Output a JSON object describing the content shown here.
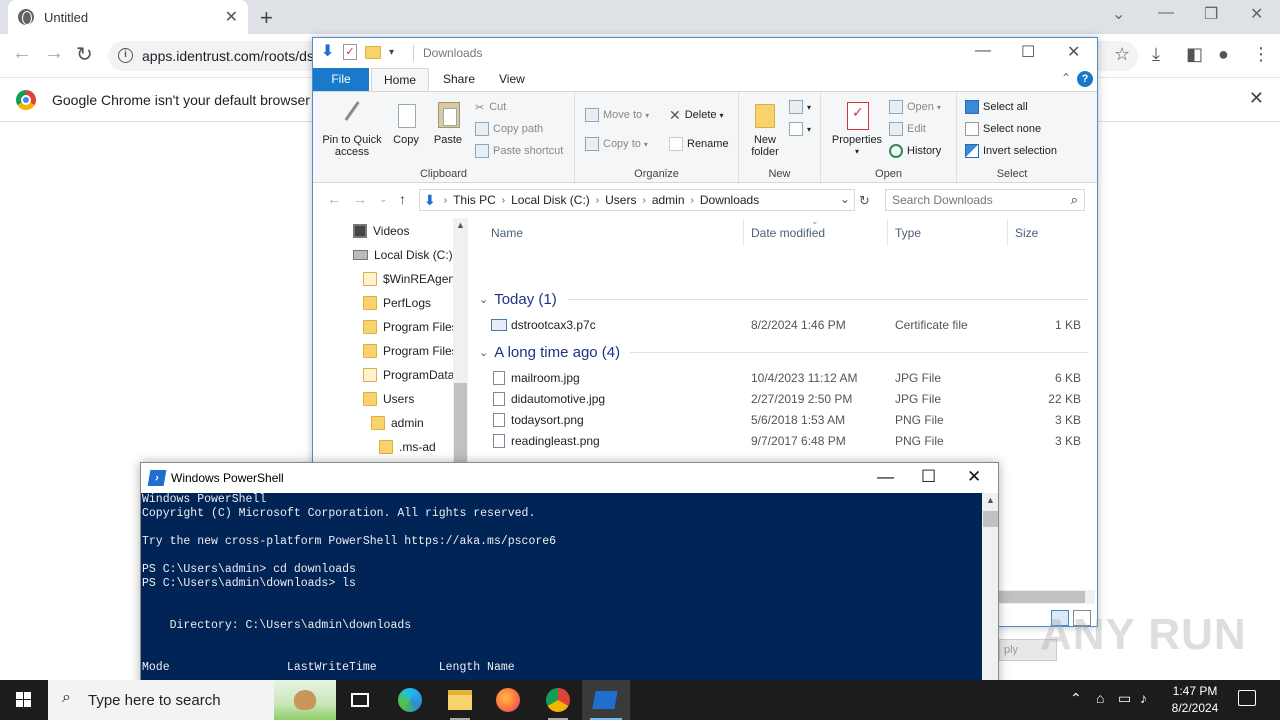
{
  "chrome": {
    "tab_title": "Untitled",
    "tab_close": "✕",
    "new_tab": "+",
    "url": "apps.identrust.com/roots/ds",
    "infobar_message": "Google Chrome isn't your default browser",
    "infobar_close": "✕"
  },
  "explorer": {
    "title": "Downloads",
    "tabs": [
      "File",
      "Home",
      "Share",
      "View"
    ],
    "help": "?",
    "clipboard": {
      "label": "Clipboard",
      "pin": "Pin to Quick access",
      "copy": "Copy",
      "paste": "Paste",
      "cut": "Cut",
      "copy_path": "Copy path",
      "paste_shortcut": "Paste shortcut"
    },
    "organize": {
      "label": "Organize",
      "move_to": "Move to",
      "copy_to": "Copy to",
      "delete": "Delete",
      "rename": "Rename"
    },
    "new": {
      "label": "New",
      "new_folder": "New folder"
    },
    "open": {
      "label": "Open",
      "properties": "Properties",
      "open": "Open",
      "edit": "Edit",
      "history": "History"
    },
    "select": {
      "label": "Select",
      "select_all": "Select all",
      "select_none": "Select none",
      "invert": "Invert selection"
    },
    "breadcrumb": [
      "This PC",
      "Local Disk (C:)",
      "Users",
      "admin",
      "Downloads"
    ],
    "search_placeholder": "Search Downloads",
    "nav_items": [
      {
        "label": "Videos"
      },
      {
        "label": "Local Disk (C:)"
      },
      {
        "label": "$WinREAgent"
      },
      {
        "label": "PerfLogs"
      },
      {
        "label": "Program Files"
      },
      {
        "label": "Program Files"
      },
      {
        "label": "ProgramData"
      },
      {
        "label": "Users"
      },
      {
        "label": "admin"
      },
      {
        "label": ".ms-ad"
      }
    ],
    "columns": [
      "Name",
      "Date modified",
      "Type",
      "Size"
    ],
    "groups": [
      {
        "label": "Today (1)",
        "files": [
          {
            "name": "dstrootcax3.p7c",
            "date": "8/2/2024 1:46 PM",
            "type": "Certificate file",
            "size": "1 KB",
            "icon": "certificate-icon"
          }
        ]
      },
      {
        "label": "A long time ago (4)",
        "files": [
          {
            "name": "mailroom.jpg",
            "date": "10/4/2023 11:12 AM",
            "type": "JPG File",
            "size": "6 KB",
            "icon": "image-file-icon"
          },
          {
            "name": "didautomotive.jpg",
            "date": "2/27/2019 2:50 PM",
            "type": "JPG File",
            "size": "22 KB",
            "icon": "image-file-icon"
          },
          {
            "name": "todaysort.png",
            "date": "5/6/2018 1:53 AM",
            "type": "PNG File",
            "size": "3 KB",
            "icon": "image-file-icon"
          },
          {
            "name": "readingleast.png",
            "date": "9/7/2017 6:48 PM",
            "type": "PNG File",
            "size": "3 KB",
            "icon": "image-file-icon"
          }
        ]
      }
    ]
  },
  "powershell": {
    "title": "Windows PowerShell",
    "lines": [
      "Windows PowerShell",
      "Copyright (C) Microsoft Corporation. All rights reserved.",
      "",
      "Try the new cross-platform PowerShell https://aka.ms/pscore6",
      "",
      "PS C:\\Users\\admin> cd downloads",
      "PS C:\\Users\\admin\\downloads> ls",
      "",
      "",
      "    Directory: C:\\Users\\admin\\downloads",
      "",
      "",
      "Mode                 LastWriteTime         Length Name"
    ]
  },
  "behind_button": "ply",
  "watermark": "ANY RUN",
  "taskbar": {
    "search_placeholder": "Type here to search",
    "time": "1:47 PM",
    "date": "8/2/2024"
  }
}
